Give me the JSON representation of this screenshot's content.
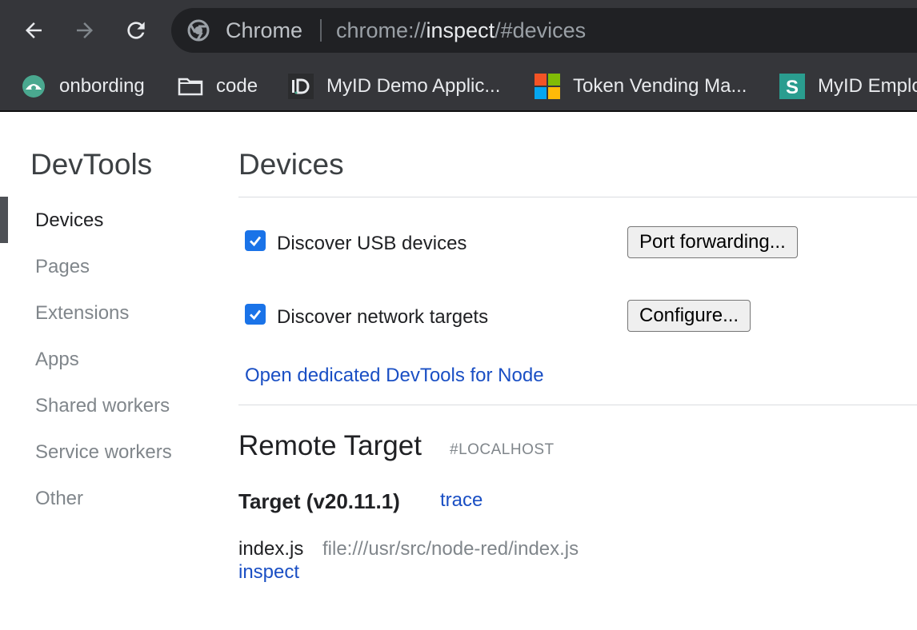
{
  "browser": {
    "omnibox": {
      "site_name": "Chrome",
      "url_scheme": "chrome://",
      "url_host": "inspect",
      "url_path": "/#devices"
    },
    "bookmarks": [
      {
        "label": "onbording",
        "icon": "onbording-favicon"
      },
      {
        "label": "code",
        "icon": "folder-icon"
      },
      {
        "label": "MyID Demo Applic...",
        "icon": "myid-favicon"
      },
      {
        "label": "Token Vending Ma...",
        "icon": "microsoft-logo-icon"
      },
      {
        "label": "MyID Emplo",
        "icon": "s-favicon"
      }
    ],
    "colors": {
      "toolbar": "#35363a",
      "omnibox": "#202124"
    }
  },
  "sidebar": {
    "title": "DevTools",
    "items": [
      {
        "label": "Devices",
        "active": true
      },
      {
        "label": "Pages"
      },
      {
        "label": "Extensions"
      },
      {
        "label": "Apps"
      },
      {
        "label": "Shared workers"
      },
      {
        "label": "Service workers"
      },
      {
        "label": "Other"
      }
    ]
  },
  "main": {
    "title": "Devices",
    "discover_usb": {
      "label": "Discover USB devices",
      "checked": true,
      "button": "Port forwarding..."
    },
    "discover_network": {
      "label": "Discover network targets",
      "checked": true,
      "button": "Configure..."
    },
    "node_link": "Open dedicated DevTools for Node",
    "remote_target": {
      "title": "Remote Target",
      "tag": "#LOCALHOST",
      "target_name": "Target (v20.11.1)",
      "trace_link": "trace",
      "item": {
        "name": "index.js",
        "url": "file:///usr/src/node-red/index.js",
        "inspect_link": "inspect"
      }
    }
  },
  "colors": {
    "link": "#1a4fc4",
    "checkbox": "#1a73e8"
  }
}
